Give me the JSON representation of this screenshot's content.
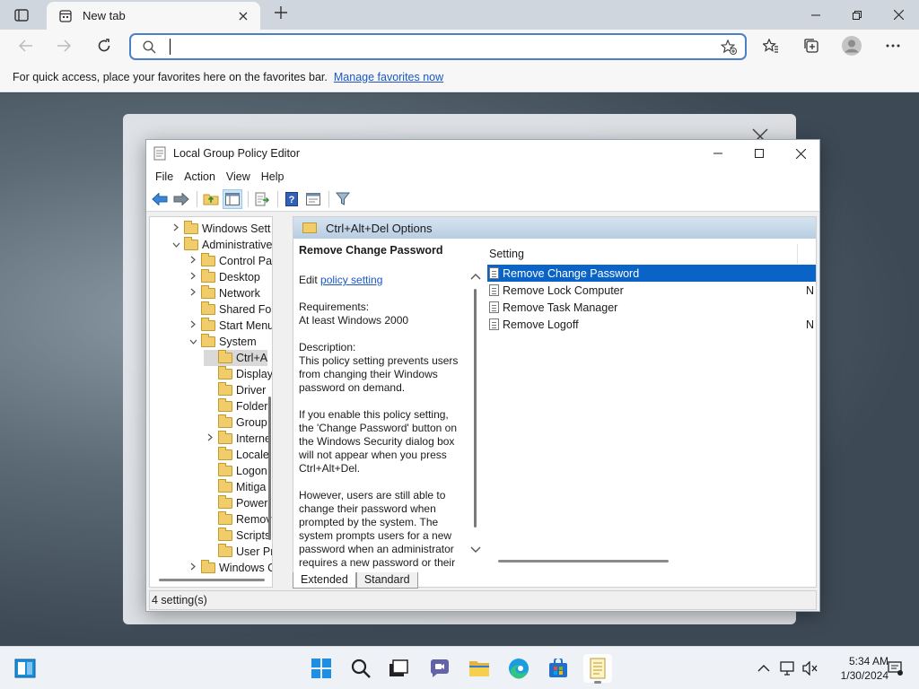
{
  "browser": {
    "tab_title": "New tab",
    "address_value": "",
    "favbar_text": "For quick access, place your favorites here on the favorites bar.",
    "favbar_link": "Manage favorites now"
  },
  "gpe": {
    "title": "Local Group Policy Editor",
    "menu": [
      "File",
      "Action",
      "View",
      "Help"
    ],
    "tree": [
      {
        "label": "Windows Sett",
        "level": 0,
        "expander": "collapsed"
      },
      {
        "label": "Administrative",
        "level": 0,
        "expander": "expanded"
      },
      {
        "label": "Control Pa",
        "level": 1,
        "expander": "collapsed"
      },
      {
        "label": "Desktop",
        "level": 1,
        "expander": "collapsed"
      },
      {
        "label": "Network",
        "level": 1,
        "expander": "collapsed"
      },
      {
        "label": "Shared Fol",
        "level": 1,
        "expander": "none"
      },
      {
        "label": "Start Menu",
        "level": 1,
        "expander": "collapsed"
      },
      {
        "label": "System",
        "level": 1,
        "expander": "expanded"
      },
      {
        "label": "Ctrl+A",
        "level": 2,
        "expander": "none",
        "selected": true
      },
      {
        "label": "Display",
        "level": 2,
        "expander": "none"
      },
      {
        "label": "Driver",
        "level": 2,
        "expander": "none"
      },
      {
        "label": "Folder",
        "level": 2,
        "expander": "none"
      },
      {
        "label": "Group",
        "level": 2,
        "expander": "none"
      },
      {
        "label": "Interne",
        "level": 2,
        "expander": "collapsed"
      },
      {
        "label": "Locale",
        "level": 2,
        "expander": "none"
      },
      {
        "label": "Logon",
        "level": 2,
        "expander": "none"
      },
      {
        "label": "Mitiga",
        "level": 2,
        "expander": "none"
      },
      {
        "label": "Power",
        "level": 2,
        "expander": "none"
      },
      {
        "label": "Remov",
        "level": 2,
        "expander": "none"
      },
      {
        "label": "Scripts",
        "level": 2,
        "expander": "none"
      },
      {
        "label": "User Pr",
        "level": 2,
        "expander": "none"
      },
      {
        "label": "Windows C",
        "level": 1,
        "expander": "collapsed"
      }
    ],
    "pane_header": "Ctrl+Alt+Del Options",
    "desc": {
      "heading": "Remove Change Password",
      "edit_prefix": "Edit",
      "edit_link": "policy setting",
      "requirements_label": "Requirements:",
      "requirements_value": "At least Windows 2000",
      "description_label": "Description:",
      "p1": "This policy setting prevents users from changing their Windows password on demand.",
      "p2": "If you enable this policy setting, the 'Change Password' button on the Windows Security dialog box will not appear when you press Ctrl+Alt+Del.",
      "p3": "However, users are still able to change their password when prompted by the system. The system prompts users for a new password when an administrator requires a new password or their"
    },
    "list_header": "Setting",
    "settings": [
      {
        "name": "Remove Change Password",
        "state": "",
        "selected": true
      },
      {
        "name": "Remove Lock Computer",
        "state": "N"
      },
      {
        "name": "Remove Task Manager",
        "state": ""
      },
      {
        "name": "Remove Logoff",
        "state": "N"
      }
    ],
    "view_tabs": [
      "Extended",
      "Standard"
    ],
    "status": "4 setting(s)"
  },
  "taskbar": {
    "time": "5:34 AM",
    "date": "1/30/2024"
  },
  "colors": {
    "accent": "#0a64c8",
    "link": "#1a57c4",
    "omnibox_border": "#4d7fc7"
  }
}
